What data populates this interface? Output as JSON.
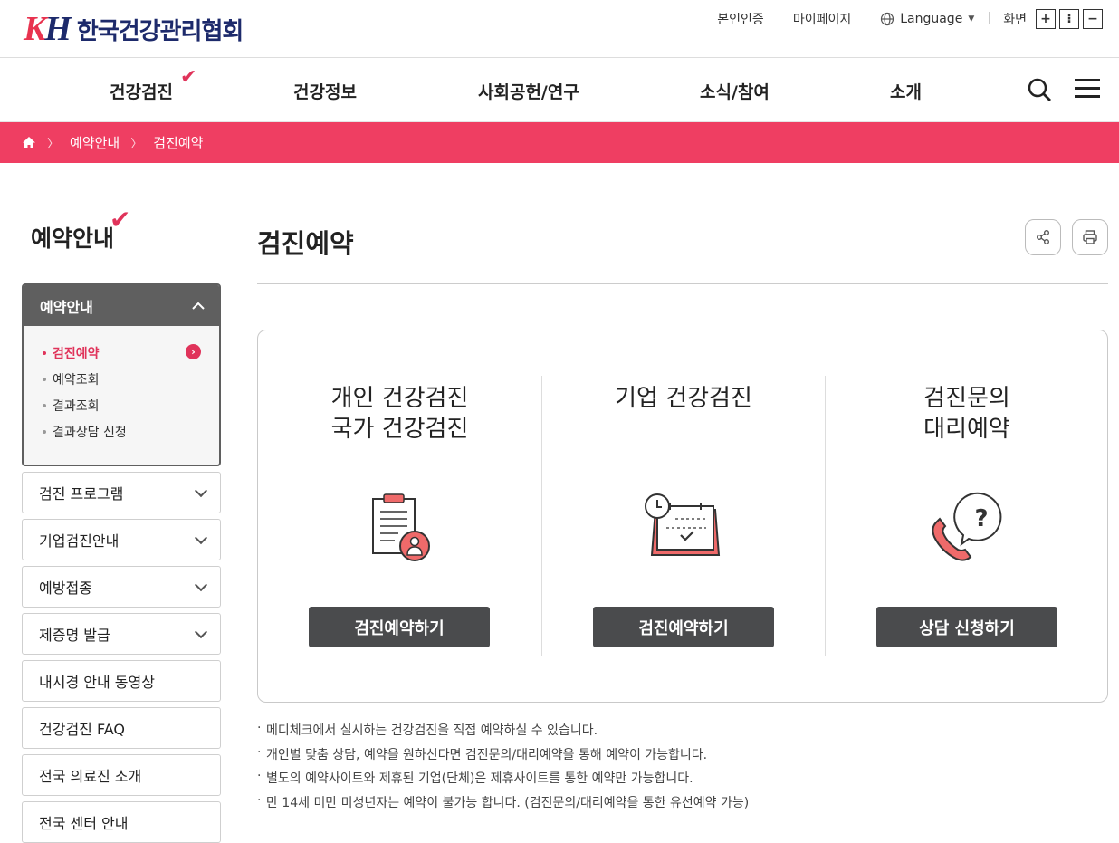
{
  "brand": {
    "logo_text": "KH",
    "name": "한국건강관리협회"
  },
  "util": {
    "verify": "본인인증",
    "mypage": "마이페이지",
    "language": "Language",
    "screen": "화면",
    "zoom_in": "+",
    "zoom_reset": "⁝",
    "zoom_out": "−"
  },
  "gnb": {
    "items": [
      "건강검진",
      "건강정보",
      "사회공헌/연구",
      "소식/참여",
      "소개"
    ]
  },
  "breadcrumb": {
    "items": [
      "예약안내",
      "검진예약"
    ]
  },
  "sidebar": {
    "title": "예약안내",
    "group": {
      "label": "예약안내",
      "items": [
        "검진예약",
        "예약조회",
        "결과조회",
        "결과상담 신청"
      ]
    },
    "nav": [
      "검진 프로그램",
      "기업검진안내",
      "예방접종",
      "제증명 발급",
      "내시경 안내 동영상",
      "건강검진 FAQ",
      "전국 의료진 소개",
      "전국 센터 안내"
    ]
  },
  "main": {
    "title": "검진예약",
    "cards": [
      {
        "title": "개인 건강검진\n국가 건강검진",
        "icon": "clipboard-person-icon",
        "button": "검진예약하기"
      },
      {
        "title": "기업 건강검진",
        "icon": "calendar-clock-icon",
        "button": "검진예약하기"
      },
      {
        "title": "검진문의\n대리예약",
        "icon": "phone-question-icon",
        "button": "상담 신청하기"
      }
    ],
    "notes": [
      "메디체크에서 실시하는 건강검진을 직접 예약하실 수 있습니다.",
      "개인별 맞춤 상담, 예약을 원하신다면 검진문의/대리예약을 통해 예약이 가능합니다.",
      "별도의 예약사이트와 제휴된 기업(단체)은 제휴사이트를 통한 예약만 가능합니다.",
      "만 14세 미만 미성년자는 예약이 불가능 합니다. (검진문의/대리예약을 통한 유선예약 가능)"
    ]
  },
  "colors": {
    "accent": "#ef3e62",
    "brand_navy": "#1d2a6b",
    "button": "#4a4b4d"
  }
}
